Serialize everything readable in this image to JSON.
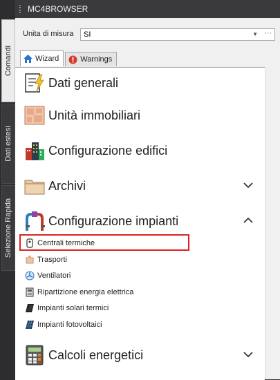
{
  "side_tabs": [
    "Comandi",
    "Dati estesi",
    "Selezione Rapida"
  ],
  "palette": {
    "title": "MC4BROWSER"
  },
  "unit": {
    "label": "Unita di misura",
    "value": "SI",
    "more": "···"
  },
  "tabs": [
    {
      "label": "Wizard"
    },
    {
      "label": "Warnings"
    }
  ],
  "sections": {
    "dati_generali": "Dati generali",
    "unita_immobiliari": "Unità immobiliari",
    "configurazione_edifici": "Configurazione edifici",
    "archivi": "Archivi",
    "configurazione_impianti": "Configurazione impianti",
    "calcoli_energetici": "Calcoli energetici"
  },
  "impianti_items": [
    {
      "label": "Centrali termiche"
    },
    {
      "label": "Trasporti"
    },
    {
      "label": "Ventilatori"
    },
    {
      "label": "Ripartizione energia elettrica"
    },
    {
      "label": "Impianti solari termici"
    },
    {
      "label": "Impianti fotovoltaici"
    }
  ],
  "colors": {
    "highlight": "#e02020",
    "panel_dark": "#2d2d30",
    "wizard_icon": "#2a73c8",
    "warning_icon": "#d83a2a"
  }
}
